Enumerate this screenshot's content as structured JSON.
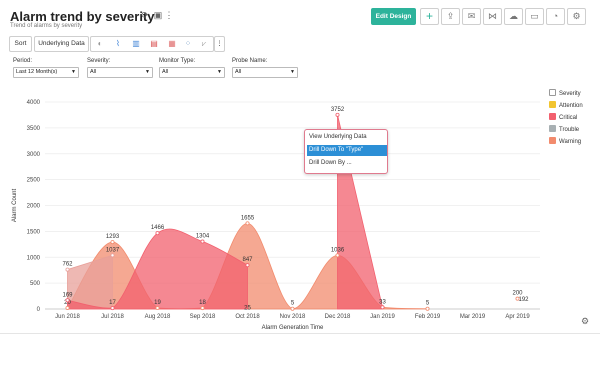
{
  "header": {
    "title": "Alarm trend by severity",
    "subtitle": "Trend of alarms by severity",
    "edit_label": "Edit Design",
    "icons": {
      "refresh": "⟳",
      "save": "▣",
      "more": "⋮"
    }
  },
  "toolbar": {
    "sort_label": "Sort",
    "underlying_label": "Underlying Data",
    "chart_type_icons": [
      "pie-chart-icon",
      "line-chart-icon",
      "bar-chart-icon",
      "stacked-bar-icon",
      "combo-chart-icon",
      "scatter-icon",
      "other-chart-icon"
    ],
    "more": "⋮"
  },
  "filters": [
    {
      "label": "Period:",
      "value": "Last 12 Month(s)"
    },
    {
      "label": "Severity:",
      "value": "All"
    },
    {
      "label": "Monitor Type:",
      "value": "All"
    },
    {
      "label": "Probe Name:",
      "value": "All"
    }
  ],
  "context_menu": {
    "items": [
      "View Underlying Data",
      "Drill Down To \"Type\"",
      "Drill Down By ..."
    ]
  },
  "chart_data": {
    "type": "area",
    "xlabel": "Alarm Generation Time",
    "ylabel": "Alarm Count",
    "ylim": [
      0,
      4000
    ],
    "yticks": [
      0,
      500,
      1000,
      1500,
      2000,
      2500,
      3000,
      3500,
      4000
    ],
    "grid": true,
    "legend_position": "right",
    "legend_title": "Severity",
    "categories": [
      "Jun 2018",
      "Jul 2018",
      "Aug 2018",
      "Sep 2018",
      "Oct 2018",
      "Nov 2018",
      "Dec 2018",
      "Jan 2019",
      "Feb 2019",
      "Mar 2019",
      "Apr 2019"
    ],
    "series": [
      {
        "name": "Attention",
        "color": "#f2c530",
        "values": [
          null,
          null,
          null,
          null,
          null,
          null,
          null,
          null,
          null,
          null,
          null
        ]
      },
      {
        "name": "Critical",
        "color": "#f2606e",
        "values": [
          169,
          17,
          1466,
          1304,
          847,
          null,
          3752,
          33,
          null,
          null,
          null
        ],
        "labels": [
          "169",
          "17",
          "1466",
          "1304",
          "847",
          "",
          "3752",
          "33",
          "",
          "",
          ""
        ]
      },
      {
        "name": "Trouble",
        "color": "#e8a09a",
        "values": [
          762,
          1037,
          null,
          null,
          null,
          null,
          null,
          null,
          null,
          null,
          null
        ],
        "labels": [
          "762",
          "1037",
          "",
          "",
          "",
          "",
          "",
          "",
          "",
          "",
          ""
        ]
      },
      {
        "name": "Warning",
        "color": "#f28b6d",
        "values": [
          20,
          1293,
          19,
          18,
          1655,
          5,
          1036,
          33,
          5,
          null,
          200
        ],
        "labels": [
          "20",
          "1293",
          "19",
          "18",
          "1655",
          "5",
          "1036",
          "",
          "5",
          "",
          "200"
        ]
      }
    ],
    "extra_labels": [
      {
        "x": "Oct 2018",
        "y": 25,
        "text": "25"
      },
      {
        "x": "Apr 2019",
        "y": 192,
        "text": "192"
      }
    ],
    "colors": {
      "attention": "#f2c530",
      "critical": "#f2606e",
      "trouble": "#a8b0b3",
      "warning": "#f28b6d"
    }
  }
}
